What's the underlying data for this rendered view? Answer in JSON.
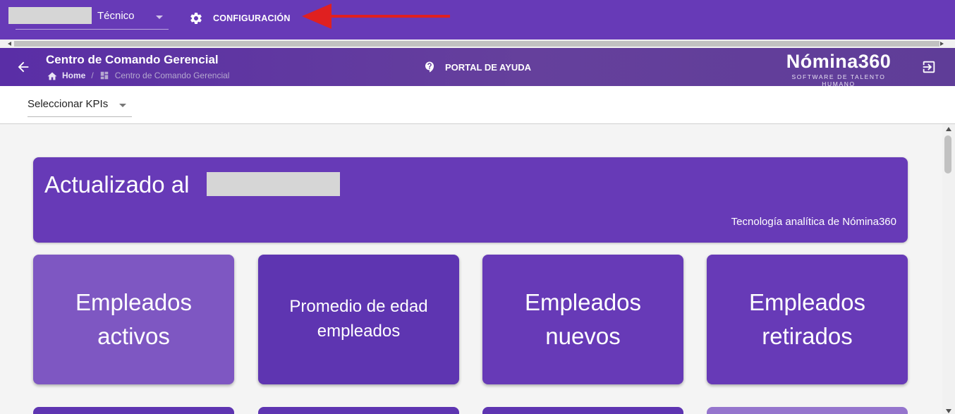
{
  "topbar": {
    "role_label": "Técnico",
    "config_label": "CONFIGURACIÓN"
  },
  "header": {
    "title": "Centro de Comando Gerencial",
    "breadcrumb": {
      "home": "Home",
      "current": "Centro de Comando Gerencial"
    },
    "help_label": "PORTAL DE AYUDA",
    "logo": {
      "brand": "Nómina360",
      "tagline": "SOFTWARE DE TALENTO HUMANO"
    }
  },
  "kpi": {
    "select_label": "Seleccionar KPIs"
  },
  "banner": {
    "headline": "Actualizado al",
    "subtitle": "Tecnología analítica de Nómina360"
  },
  "cards": [
    {
      "label": "Empleados activos",
      "color": "#7e57c2"
    },
    {
      "label": "Promedio de edad empleados",
      "color": "#5e35b1"
    },
    {
      "label": "Empleados nuevos",
      "color": "#673ab7"
    },
    {
      "label": "Empleados retirados",
      "color": "#673ab7"
    }
  ],
  "colors": {
    "primary": "#673ab7",
    "annotation_arrow": "#e02020"
  }
}
